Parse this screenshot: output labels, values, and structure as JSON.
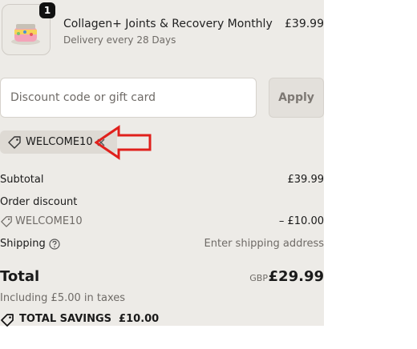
{
  "product": {
    "quantity": "1",
    "title": "Collagen+ Joints & Recovery Monthly",
    "subtitle": "Delivery every 28 Days",
    "price": "£39.99",
    "image_icon": "product-jar-icon"
  },
  "discount": {
    "placeholder": "Discount code or gift card",
    "apply_label": "Apply",
    "applied_code": "WELCOME10",
    "tag_icon": "tag-icon",
    "remove_icon": "close-icon"
  },
  "summary": {
    "subtotal_label": "Subtotal",
    "subtotal_value": "£39.99",
    "order_discount_label": "Order discount",
    "discount_code": "WELCOME10",
    "discount_value": "– £10.00",
    "shipping_label": "Shipping",
    "shipping_value": "Enter shipping address",
    "total_label": "Total",
    "currency": "GBP",
    "total_value": "£29.99",
    "taxes_text": "Including £5.00 in taxes",
    "savings_text": "TOTAL SAVINGS  £10.00"
  },
  "annotation": {
    "arrow_color": "#e0201c",
    "arrow_icon": "left-arrow-annotation"
  }
}
